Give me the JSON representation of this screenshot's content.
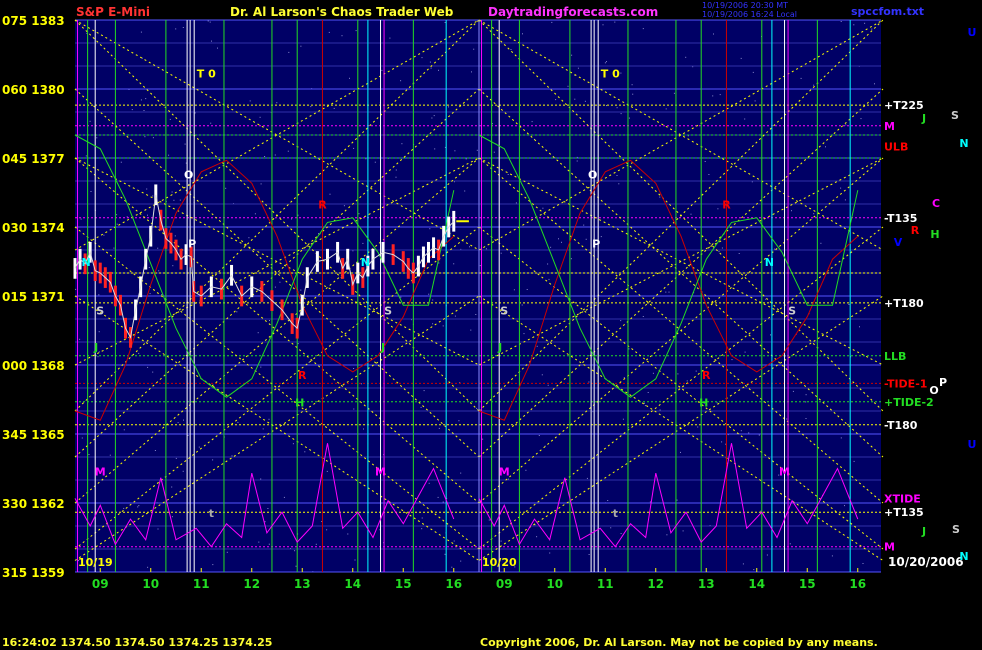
{
  "header": {
    "symbol": "S&P E-Mini",
    "title": "Dr. Al Larson's Chaos Trader Web",
    "site": "Daytradingforecasts.com",
    "timestamp_line1": "10/19/2006 20:30 MT",
    "timestamp_line2": "10/19/2006 16:24 Local",
    "ephem_file": "spccfom.txt"
  },
  "footer": {
    "quote": "16:24:02  1374.50 1374.50 1374.25 1374.25",
    "copyright": "Copyright 2006, Dr. Al Larson. May not be copied by any means."
  },
  "colors": {
    "background": "#000000",
    "plot_bg": "#000066",
    "grid": "#5555ff",
    "yellow": "#ffff00",
    "green": "#22dd22",
    "red": "#cc0000",
    "magenta": "#ff00ff",
    "white": "#ffffff",
    "cyan": "#00ffff",
    "blue": "#0000ff"
  },
  "chart_data": {
    "type": "line",
    "title": "S&P E-Mini",
    "xlabel": "",
    "ylabel": "",
    "ylim": [
      1359,
      1383
    ],
    "grid": true,
    "legend": "none",
    "y_ticks": [
      {
        "angle": "075",
        "price": "1383",
        "value": 1383
      },
      {
        "angle": "060",
        "price": "1380",
        "value": 1380
      },
      {
        "angle": "045",
        "price": "1377",
        "value": 1377
      },
      {
        "angle": "030",
        "price": "1374",
        "value": 1374
      },
      {
        "angle": "015",
        "price": "1371",
        "value": 1371
      },
      {
        "angle": "000",
        "price": "1368",
        "value": 1368
      },
      {
        "angle": "345",
        "price": "1365",
        "value": 1365
      },
      {
        "angle": "330",
        "price": "1362",
        "value": 1362
      },
      {
        "angle": "315",
        "price": "1359",
        "value": 1359
      }
    ],
    "x_ticks_day1": [
      "09",
      "10",
      "11",
      "12",
      "13",
      "14",
      "15",
      "16"
    ],
    "x_ticks_day2": [
      "09",
      "10",
      "11",
      "12",
      "13",
      "14",
      "15",
      "16"
    ],
    "x_ticks_hours": [
      9,
      10,
      11,
      12,
      13,
      14,
      15,
      16
    ],
    "date_labels": [
      "10/19",
      "10/20",
      "10/20/2006"
    ],
    "right_labels": [
      {
        "text": "+T225",
        "color": "#ffffff",
        "value": 1379.3
      },
      {
        "text": "M",
        "color": "#ff00ff",
        "value": 1378.4
      },
      {
        "text": "ULB",
        "color": "#ff0000",
        "value": 1377.5
      },
      {
        "text": "-T135",
        "color": "#ffffff",
        "value": 1374.4
      },
      {
        "text": "+T180",
        "color": "#ffffff",
        "value": 1370.7
      },
      {
        "text": "LLB",
        "color": "#22dd22",
        "value": 1368.4
      },
      {
        "text": "-TIDE-1",
        "color": "#ff0000",
        "value": 1367.2
      },
      {
        "text": "+TIDE-2",
        "color": "#22dd22",
        "value": 1366.4
      },
      {
        "text": "-T180",
        "color": "#ffffff",
        "value": 1365.4
      },
      {
        "text": "XTIDE",
        "color": "#ff00ff",
        "value": 1362.2
      },
      {
        "text": "+T135",
        "color": "#ffffff",
        "value": 1361.6
      },
      {
        "text": "M",
        "color": "#ff00ff",
        "value": 1360.1
      }
    ],
    "planet_labels": [
      {
        "text": "U",
        "color": "#0000ff"
      },
      {
        "text": "S",
        "color": "#cccccc"
      },
      {
        "text": "J",
        "color": "#22dd22"
      },
      {
        "text": "N",
        "color": "#00ffff"
      },
      {
        "text": "C",
        "color": "#ff00ff"
      },
      {
        "text": "R",
        "color": "#ff0000"
      },
      {
        "text": "H",
        "color": "#22dd22"
      },
      {
        "text": "V",
        "color": "#0000ff"
      },
      {
        "text": "O",
        "color": "#ffffff"
      },
      {
        "text": "P",
        "color": "#ffffff"
      },
      {
        "text": "U",
        "color": "#0000ff"
      },
      {
        "text": "J",
        "color": "#22dd22"
      },
      {
        "text": "S",
        "color": "#cccccc"
      },
      {
        "text": "N",
        "color": "#00ffff"
      }
    ],
    "timing_marks": [
      {
        "text": "T 0",
        "color": "#ffff00",
        "day": 1,
        "hour": 11.1,
        "value": 1380.5
      },
      {
        "text": "T 0",
        "color": "#ffff00",
        "day": 2,
        "hour": 11.1,
        "value": 1380.5
      },
      {
        "text": "O",
        "color": "#ffffff",
        "day": 1,
        "hour": 10.75,
        "value": 1376.1
      },
      {
        "text": "O",
        "color": "#ffffff",
        "day": 2,
        "hour": 10.75,
        "value": 1376.1
      },
      {
        "text": "P",
        "color": "#ffffff",
        "day": 1,
        "hour": 10.82,
        "value": 1373.1
      },
      {
        "text": "P",
        "color": "#ffffff",
        "day": 2,
        "hour": 10.82,
        "value": 1373.1
      },
      {
        "text": "R",
        "color": "#ff0000",
        "day": 1,
        "hour": 13.4,
        "value": 1374.8
      },
      {
        "text": "R",
        "color": "#ff0000",
        "day": 2,
        "hour": 13.4,
        "value": 1374.8
      },
      {
        "text": "R",
        "color": "#ff0000",
        "day": 1,
        "hour": 13.0,
        "value": 1367.4
      },
      {
        "text": "R",
        "color": "#ff0000",
        "day": 2,
        "hour": 13.0,
        "value": 1367.4
      },
      {
        "text": "S",
        "color": "#cccccc",
        "day": 1,
        "hour": 9.0,
        "value": 1370.2
      },
      {
        "text": "S",
        "color": "#cccccc",
        "day": 2,
        "hour": 9.0,
        "value": 1370.2
      },
      {
        "text": "S",
        "color": "#cccccc",
        "day": 1,
        "hour": 14.7,
        "value": 1370.2
      },
      {
        "text": "S",
        "color": "#cccccc",
        "day": 2,
        "hour": 14.7,
        "value": 1370.2
      },
      {
        "text": "J",
        "color": "#22dd22",
        "day": 1,
        "hour": 8.92,
        "value": 1368.6
      },
      {
        "text": "J",
        "color": "#22dd22",
        "day": 2,
        "hour": 8.92,
        "value": 1368.6
      },
      {
        "text": "J",
        "color": "#22dd22",
        "day": 1,
        "hour": 14.6,
        "value": 1368.6
      },
      {
        "text": "H",
        "color": "#22dd22",
        "day": 1,
        "hour": 12.95,
        "value": 1366.2
      },
      {
        "text": "H",
        "color": "#22dd22",
        "day": 2,
        "hour": 12.95,
        "value": 1366.2
      },
      {
        "text": "N",
        "color": "#00ffff",
        "day": 1,
        "hour": 8.72,
        "value": 1372.3
      },
      {
        "text": "N",
        "color": "#00ffff",
        "day": 1,
        "hour": 14.25,
        "value": 1372.3
      },
      {
        "text": "N",
        "color": "#00ffff",
        "day": 2,
        "hour": 14.25,
        "value": 1372.3
      },
      {
        "text": "M",
        "color": "#ff00ff",
        "day": 1,
        "hour": 9.0,
        "value": 1363.2
      },
      {
        "text": "M",
        "color": "#ff00ff",
        "day": 1,
        "hour": 14.55,
        "value": 1363.2
      },
      {
        "text": "M",
        "color": "#ff00ff",
        "day": 2,
        "hour": 9.0,
        "value": 1363.2
      },
      {
        "text": "M",
        "color": "#ff00ff",
        "day": 2,
        "hour": 14.55,
        "value": 1363.2
      },
      {
        "text": "t",
        "color": "#aaaaaa",
        "day": 1,
        "hour": 11.2,
        "value": 1361.4
      },
      {
        "text": "t",
        "color": "#aaaaaa",
        "day": 2,
        "hour": 11.2,
        "value": 1361.4
      }
    ],
    "price_series": [
      {
        "hour": 8.5,
        "value": 1372.2
      },
      {
        "hour": 8.6,
        "value": 1372.6
      },
      {
        "hour": 8.7,
        "value": 1372.4
      },
      {
        "hour": 8.8,
        "value": 1372.9
      },
      {
        "hour": 8.9,
        "value": 1372.1
      },
      {
        "hour": 9.0,
        "value": 1372.0
      },
      {
        "hour": 9.1,
        "value": 1371.8
      },
      {
        "hour": 9.2,
        "value": 1371.6
      },
      {
        "hour": 9.3,
        "value": 1371.0
      },
      {
        "hour": 9.4,
        "value": 1370.6
      },
      {
        "hour": 9.5,
        "value": 1369.6
      },
      {
        "hour": 9.6,
        "value": 1369.2
      },
      {
        "hour": 9.7,
        "value": 1370.4
      },
      {
        "hour": 9.8,
        "value": 1371.4
      },
      {
        "hour": 9.9,
        "value": 1372.6
      },
      {
        "hour": 10.0,
        "value": 1373.6
      },
      {
        "hour": 10.1,
        "value": 1375.4
      },
      {
        "hour": 10.2,
        "value": 1374.3
      },
      {
        "hour": 10.3,
        "value": 1373.5
      },
      {
        "hour": 10.4,
        "value": 1373.3
      },
      {
        "hour": 10.5,
        "value": 1373.0
      },
      {
        "hour": 10.6,
        "value": 1372.6
      },
      {
        "hour": 10.7,
        "value": 1372.8
      },
      {
        "hour": 10.8,
        "value": 1372.7
      },
      {
        "hour": 10.85,
        "value": 1371.2
      },
      {
        "hour": 11.0,
        "value": 1371.0
      },
      {
        "hour": 11.2,
        "value": 1371.4
      },
      {
        "hour": 11.4,
        "value": 1371.3
      },
      {
        "hour": 11.6,
        "value": 1371.9
      },
      {
        "hour": 11.8,
        "value": 1371.0
      },
      {
        "hour": 12.0,
        "value": 1371.4
      },
      {
        "hour": 12.2,
        "value": 1371.2
      },
      {
        "hour": 12.4,
        "value": 1370.8
      },
      {
        "hour": 12.6,
        "value": 1370.4
      },
      {
        "hour": 12.8,
        "value": 1369.8
      },
      {
        "hour": 12.9,
        "value": 1369.6
      },
      {
        "hour": 13.0,
        "value": 1370.6
      },
      {
        "hour": 13.1,
        "value": 1371.8
      },
      {
        "hour": 13.3,
        "value": 1372.5
      },
      {
        "hour": 13.5,
        "value": 1372.6
      },
      {
        "hour": 13.7,
        "value": 1372.9
      },
      {
        "hour": 13.8,
        "value": 1372.2
      },
      {
        "hour": 13.9,
        "value": 1372.6
      },
      {
        "hour": 14.0,
        "value": 1371.5
      },
      {
        "hour": 14.1,
        "value": 1372.0
      },
      {
        "hour": 14.2,
        "value": 1371.8
      },
      {
        "hour": 14.3,
        "value": 1372.3
      },
      {
        "hour": 14.4,
        "value": 1372.6
      },
      {
        "hour": 14.6,
        "value": 1372.9
      },
      {
        "hour": 14.8,
        "value": 1372.8
      },
      {
        "hour": 15.0,
        "value": 1372.5
      },
      {
        "hour": 15.1,
        "value": 1372.2
      },
      {
        "hour": 15.2,
        "value": 1372.0
      },
      {
        "hour": 15.3,
        "value": 1372.3
      },
      {
        "hour": 15.4,
        "value": 1372.7
      },
      {
        "hour": 15.5,
        "value": 1372.9
      },
      {
        "hour": 15.6,
        "value": 1373.1
      },
      {
        "hour": 15.7,
        "value": 1373.0
      },
      {
        "hour": 15.8,
        "value": 1373.6
      },
      {
        "hour": 15.9,
        "value": 1374.0
      },
      {
        "hour": 16.0,
        "value": 1374.25
      }
    ],
    "red_line": [
      {
        "hour": 8.5,
        "value": 1366.0
      },
      {
        "hour": 9.0,
        "value": 1365.6
      },
      {
        "hour": 9.5,
        "value": 1368.0
      },
      {
        "hour": 10.0,
        "value": 1371.5
      },
      {
        "hour": 10.5,
        "value": 1374.6
      },
      {
        "hour": 11.0,
        "value": 1376.4
      },
      {
        "hour": 11.5,
        "value": 1376.9
      },
      {
        "hour": 12.0,
        "value": 1375.9
      },
      {
        "hour": 12.5,
        "value": 1373.6
      },
      {
        "hour": 13.0,
        "value": 1370.6
      },
      {
        "hour": 13.5,
        "value": 1368.4
      },
      {
        "hour": 14.0,
        "value": 1367.7
      },
      {
        "hour": 14.5,
        "value": 1368.4
      },
      {
        "hour": 15.0,
        "value": 1370.1
      },
      {
        "hour": 15.5,
        "value": 1372.6
      },
      {
        "hour": 16.0,
        "value": 1373.6
      }
    ],
    "green_line": [
      {
        "hour": 8.5,
        "value": 1378.0
      },
      {
        "hour": 9.0,
        "value": 1377.4
      },
      {
        "hour": 9.5,
        "value": 1375.2
      },
      {
        "hour": 10.0,
        "value": 1372.4
      },
      {
        "hour": 10.5,
        "value": 1369.6
      },
      {
        "hour": 11.0,
        "value": 1367.4
      },
      {
        "hour": 11.5,
        "value": 1366.6
      },
      {
        "hour": 12.0,
        "value": 1367.4
      },
      {
        "hour": 12.5,
        "value": 1369.8
      },
      {
        "hour": 13.0,
        "value": 1372.6
      },
      {
        "hour": 13.5,
        "value": 1374.2
      },
      {
        "hour": 14.0,
        "value": 1374.4
      },
      {
        "hour": 14.5,
        "value": 1372.9
      },
      {
        "hour": 15.0,
        "value": 1370.6
      },
      {
        "hour": 15.5,
        "value": 1370.6
      },
      {
        "hour": 16.0,
        "value": 1375.6
      }
    ],
    "magenta_line": [
      {
        "hour": 8.5,
        "value": 1362.2
      },
      {
        "hour": 8.8,
        "value": 1361.0
      },
      {
        "hour": 9.0,
        "value": 1361.9
      },
      {
        "hour": 9.3,
        "value": 1360.2
      },
      {
        "hour": 9.6,
        "value": 1361.3
      },
      {
        "hour": 9.9,
        "value": 1360.4
      },
      {
        "hour": 10.2,
        "value": 1363.1
      },
      {
        "hour": 10.5,
        "value": 1360.4
      },
      {
        "hour": 10.9,
        "value": 1360.9
      },
      {
        "hour": 11.2,
        "value": 1360.1
      },
      {
        "hour": 11.5,
        "value": 1361.1
      },
      {
        "hour": 11.8,
        "value": 1360.5
      },
      {
        "hour": 12.0,
        "value": 1363.3
      },
      {
        "hour": 12.3,
        "value": 1360.7
      },
      {
        "hour": 12.6,
        "value": 1361.6
      },
      {
        "hour": 12.9,
        "value": 1360.3
      },
      {
        "hour": 13.2,
        "value": 1361.0
      },
      {
        "hour": 13.5,
        "value": 1364.6
      },
      {
        "hour": 13.8,
        "value": 1360.9
      },
      {
        "hour": 14.1,
        "value": 1361.6
      },
      {
        "hour": 14.4,
        "value": 1360.5
      },
      {
        "hour": 14.7,
        "value": 1362.1
      },
      {
        "hour": 15.0,
        "value": 1361.1
      },
      {
        "hour": 15.3,
        "value": 1362.3
      },
      {
        "hour": 15.6,
        "value": 1363.5
      },
      {
        "hour": 16.0,
        "value": 1361.3
      }
    ]
  }
}
